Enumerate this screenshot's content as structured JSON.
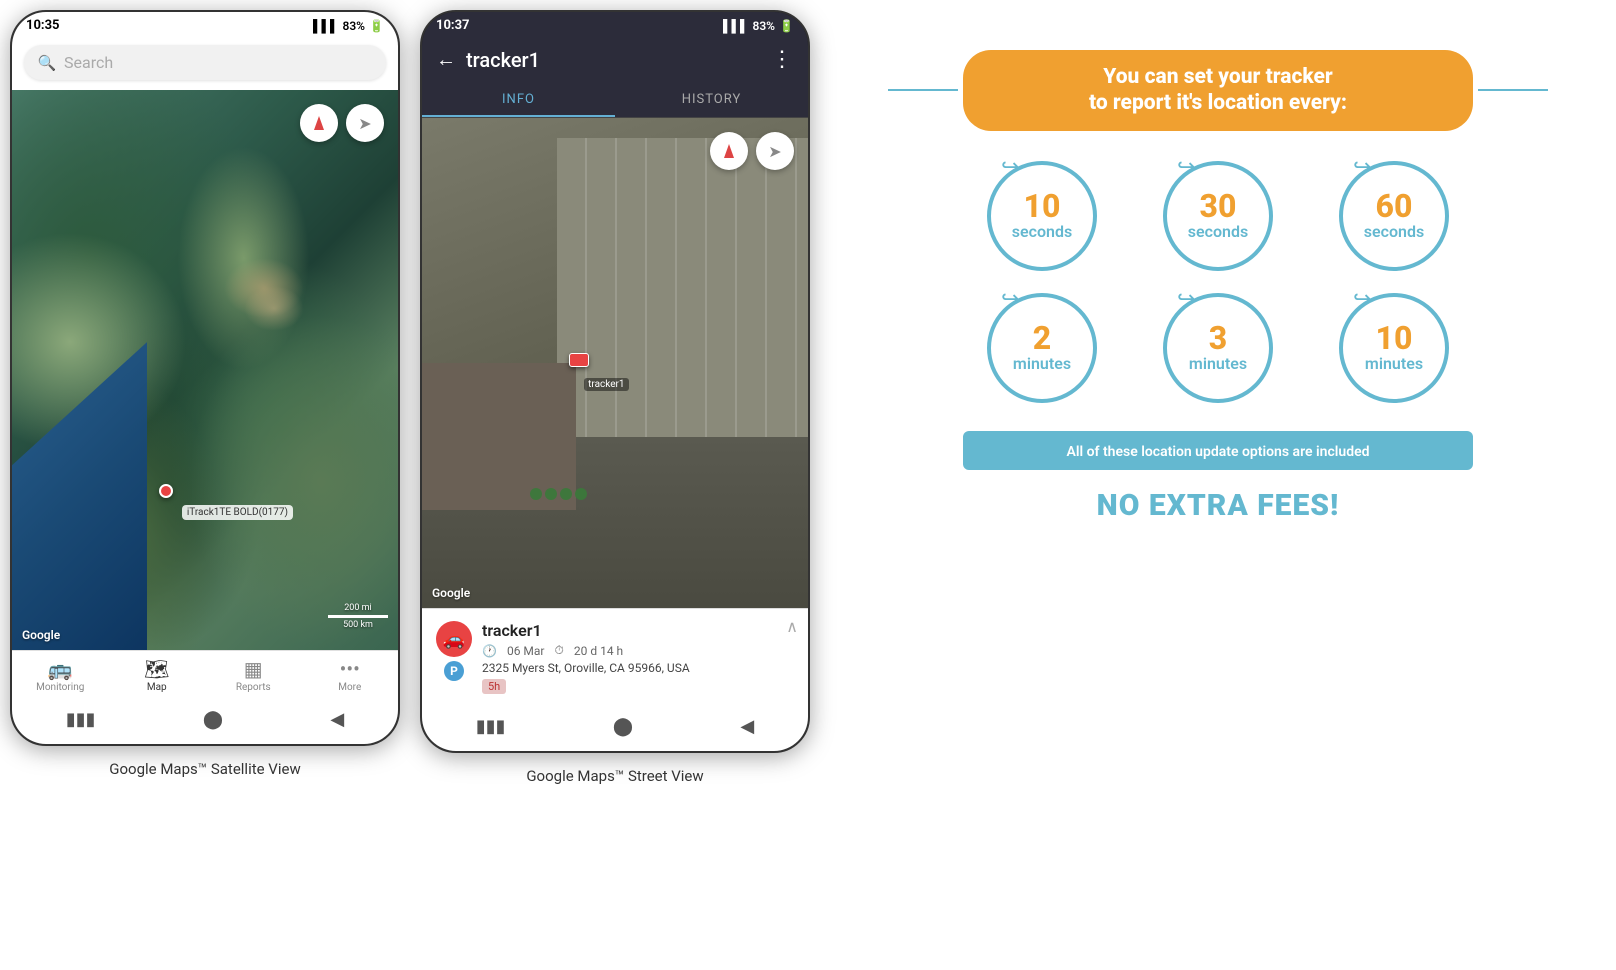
{
  "phones": {
    "left": {
      "status_time": "10:35",
      "status_signal": "▌▌▌",
      "status_battery": "83%",
      "search_placeholder": "Search",
      "compass_label": "compass",
      "nav_label": "navigate",
      "tracker_name_map": "iTrack1TE BOLD(0177)",
      "google_watermark": "Google",
      "scale_top": "200 mi",
      "scale_bottom": "500 km",
      "nav_tabs": [
        {
          "label": "Monitoring",
          "icon": "⊞",
          "active": false
        },
        {
          "label": "Map",
          "icon": "⬛",
          "active": true
        },
        {
          "label": "Reports",
          "icon": "▦",
          "active": false
        },
        {
          "label": "More",
          "icon": "•••",
          "active": false
        }
      ],
      "caption": "Google Maps™ Satellite View"
    },
    "right": {
      "status_time": "10:37",
      "status_signal": "▌▌▌",
      "status_battery": "83%",
      "header_title": "tracker1",
      "back_btn": "←",
      "menu_btn": "⋮",
      "tabs": [
        {
          "label": "INFO",
          "active": true
        },
        {
          "label": "HISTORY",
          "active": false
        }
      ],
      "google_watermark": "Google",
      "tracker_info": {
        "name": "tracker1",
        "date": "06 Mar",
        "duration": "20 d 14 h",
        "address": "2325 Myers St, Oroville, CA 95966, USA",
        "time_badge": "5h"
      },
      "caption": "Google Maps™ Street View"
    }
  },
  "infographic": {
    "title_line1": "You can set your tracker",
    "title_line2": "to report it's location every:",
    "circles": [
      {
        "number": "10",
        "unit": "seconds"
      },
      {
        "number": "30",
        "unit": "seconds"
      },
      {
        "number": "60",
        "unit": "seconds"
      },
      {
        "number": "2",
        "unit": "minutes"
      },
      {
        "number": "3",
        "unit": "minutes"
      },
      {
        "number": "10",
        "unit": "minutes"
      }
    ],
    "banner_text": "All of these location update options are included",
    "no_fee_text": "NO EXTRA FEES!",
    "accent_color": "#f0a030",
    "circle_color": "#64b8d0"
  }
}
